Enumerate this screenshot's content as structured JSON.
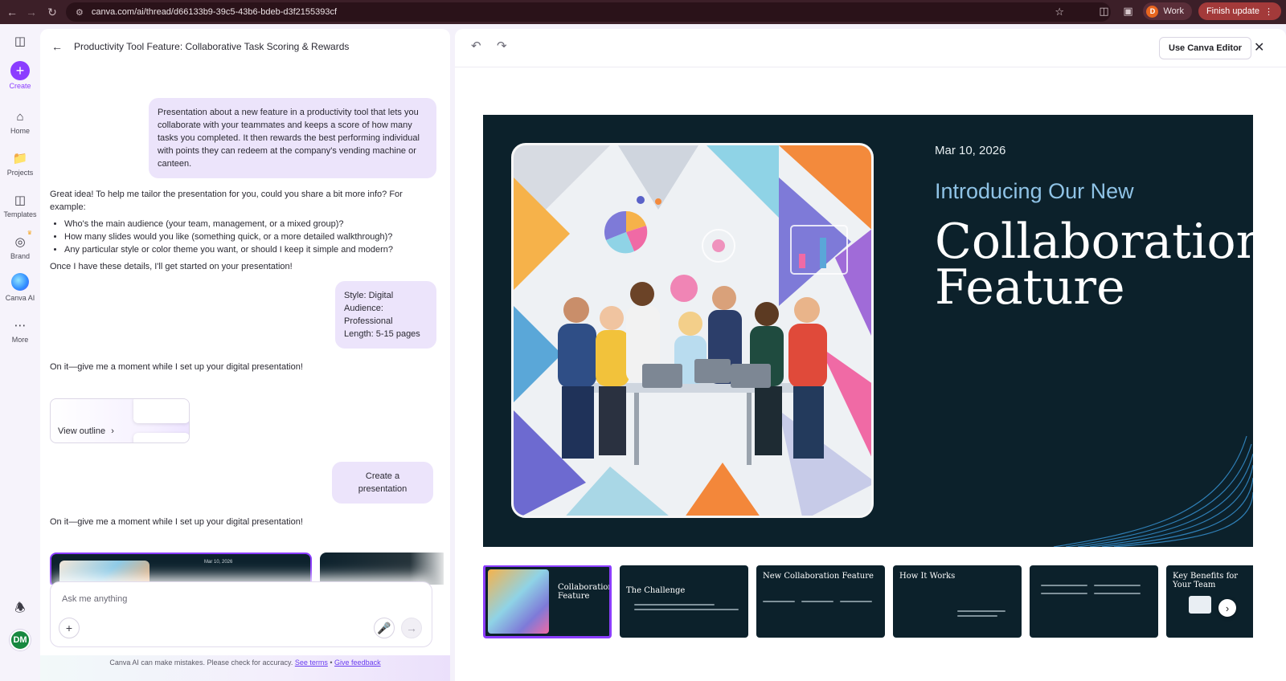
{
  "browser": {
    "url": "canva.com/ai/thread/d66133b9-39c5-43b6-bdeb-d3f2155393cf",
    "profile_initial": "D",
    "profile_label": "Work",
    "update_label": "Finish update"
  },
  "rail": {
    "create": "Create",
    "home": "Home",
    "projects": "Projects",
    "templates": "Templates",
    "brand": "Brand",
    "canva_ai": "Canva AI",
    "more": "More",
    "avatar_initials": "DM"
  },
  "chat": {
    "title": "Productivity Tool Feature: Collaborative Task Scoring & Rewards",
    "user_msg_1": "Presentation about a new feature in a productivity tool that lets you collaborate with your teammates and keeps a score of how many tasks you completed. It then rewards the best performing individual with points they can redeem at the company's vending machine or canteen.",
    "ai_msg_1_intro": "Great idea! To help me tailor the presentation for you, could you share a bit more info? For example:",
    "ai_msg_1_bullets": [
      "Who's the main audience (your team, management, or a mixed group)?",
      "How many slides would you like (something quick, or a more detailed walkthrough)?",
      "Any particular style or color theme you want, or should I keep it simple and modern?"
    ],
    "ai_msg_1_outro": "Once I have these details, I'll get started on your presentation!",
    "user_msg_2_lines": [
      "Style: Digital",
      "Audience: Professional",
      "Length: 5-15 pages"
    ],
    "ai_msg_2": "On it—give me a moment while I set up your digital presentation!",
    "outline_button": "View outline",
    "user_msg_3": "Create a presentation",
    "ai_msg_3": "On it—give me a moment while I set up your digital presentation!",
    "strip_date": "Mar 10, 2026",
    "composer_placeholder": "Ask me anything",
    "disclaimer_text": "Canva AI can make mistakes. Please check for accuracy.",
    "disclaimer_terms": "See terms",
    "disclaimer_sep": "•",
    "disclaimer_feedback": "Give feedback"
  },
  "preview": {
    "use_editor": "Use Canva Editor",
    "slide": {
      "date": "Mar 10, 2026",
      "subtitle": "Introducing Our New",
      "title": "Collaboration Feature"
    },
    "thumbnails": [
      {
        "title": "Collaboration Feature"
      },
      {
        "title": "The Challenge"
      },
      {
        "title": "New Collaboration Feature"
      },
      {
        "title": "How It Works"
      },
      {
        "title": ""
      },
      {
        "title": "Key Benefits for Your Team"
      }
    ]
  },
  "colors": {
    "accent": "#8b3dff",
    "slide_bg": "#0c212b",
    "subtitle": "#8fc3e6",
    "browser_bar": "#3c1f28",
    "finish_update": "#a33a3a"
  }
}
